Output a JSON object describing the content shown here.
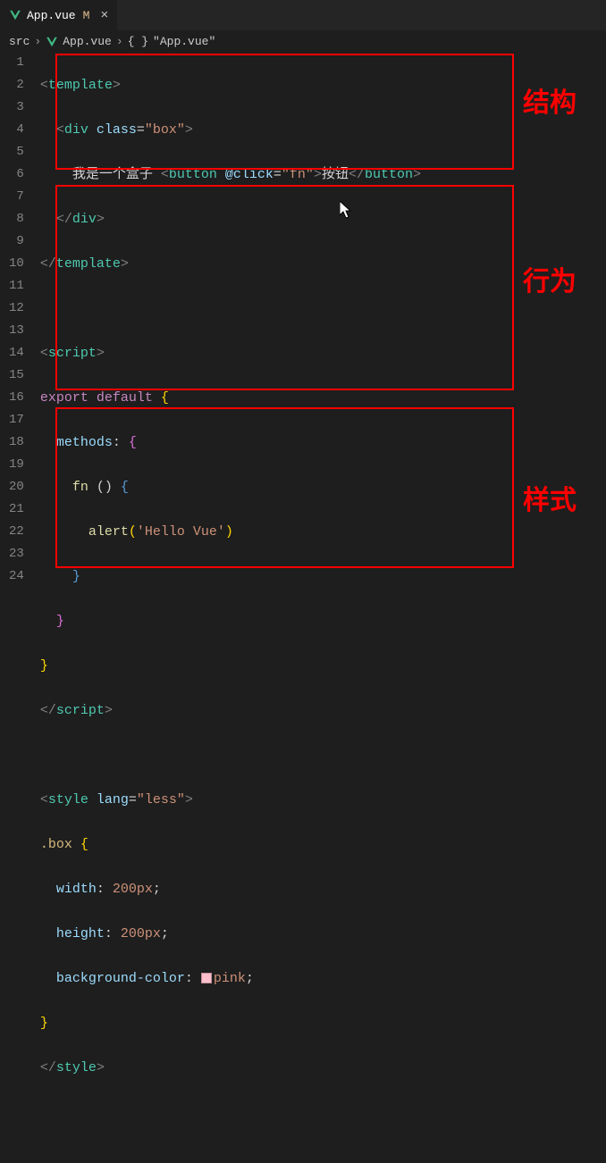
{
  "tab": {
    "filename": "App.vue",
    "modified_marker": "M",
    "close_icon": "×"
  },
  "breadcrumb": {
    "seg1": "src",
    "seg2": "App.vue",
    "seg3_braces": "{ }",
    "seg3": "\"App.vue\"",
    "chevron": "›"
  },
  "code": {
    "line1": {
      "open": "<",
      "tag": "template",
      "close": ">"
    },
    "line2": {
      "indent": "  ",
      "open": "<",
      "tag": "div",
      "sp": " ",
      "attr": "class",
      "eq": "=",
      "val": "\"box\"",
      "close": ">"
    },
    "line3": {
      "indent": "    ",
      "text": "我是一个盒子 ",
      "open": "<",
      "tag": "button",
      "sp": " ",
      "attr": "@click",
      "eq": "=",
      "val": "\"fn\"",
      "close": ">",
      "inner": "按钮",
      "open2": "</",
      "tag2": "button",
      "close2": ">"
    },
    "line4": {
      "indent": "  ",
      "open": "</",
      "tag": "div",
      "close": ">"
    },
    "line5": {
      "open": "</",
      "tag": "template",
      "close": ">"
    },
    "line7": {
      "open": "<",
      "tag": "script",
      "close": ">"
    },
    "line8": {
      "kw1": "export",
      "sp": " ",
      "kw2": "default",
      "sp2": " ",
      "brace": "{"
    },
    "line9": {
      "indent": "  ",
      "prop": "methods",
      "colon": ":",
      "sp": " ",
      "brace": "{"
    },
    "line10": {
      "indent": "    ",
      "func": "fn",
      "sp": " ",
      "paren": "()",
      "sp2": " ",
      "brace": "{"
    },
    "line11": {
      "indent": "      ",
      "func": "alert",
      "paren1": "(",
      "str": "'Hello Vue'",
      "paren2": ")"
    },
    "line12": {
      "indent": "    ",
      "brace": "}"
    },
    "line13": {
      "indent": "  ",
      "brace": "}"
    },
    "line14": {
      "brace": "}"
    },
    "line15": {
      "open": "</",
      "tag": "script",
      "close": ">"
    },
    "line17": {
      "open": "<",
      "tag": "style",
      "sp": " ",
      "attr": "lang",
      "eq": "=",
      "val": "\"less\"",
      "close": ">"
    },
    "line18": {
      "sel": ".box",
      "sp": " ",
      "brace": "{"
    },
    "line19": {
      "indent": "  ",
      "key": "width",
      "colon": ":",
      "sp": " ",
      "val": "200px",
      "semi": ";"
    },
    "line20": {
      "indent": "  ",
      "key": "height",
      "colon": ":",
      "sp": " ",
      "val": "200px",
      "semi": ";"
    },
    "line21": {
      "indent": "  ",
      "key": "background-color",
      "colon": ":",
      "sp": " ",
      "val": "pink",
      "semi": ";"
    },
    "line22": {
      "brace": "}"
    },
    "line23": {
      "open": "</",
      "tag": "style",
      "close": ">"
    }
  },
  "line_numbers": [
    "1",
    "2",
    "3",
    "4",
    "5",
    "6",
    "7",
    "8",
    "9",
    "10",
    "11",
    "12",
    "13",
    "14",
    "15",
    "16",
    "17",
    "18",
    "19",
    "20",
    "21",
    "22",
    "23",
    "24"
  ],
  "annotations": {
    "box1_label": "结构",
    "box2_label": "行为",
    "box3_label": "样式"
  }
}
